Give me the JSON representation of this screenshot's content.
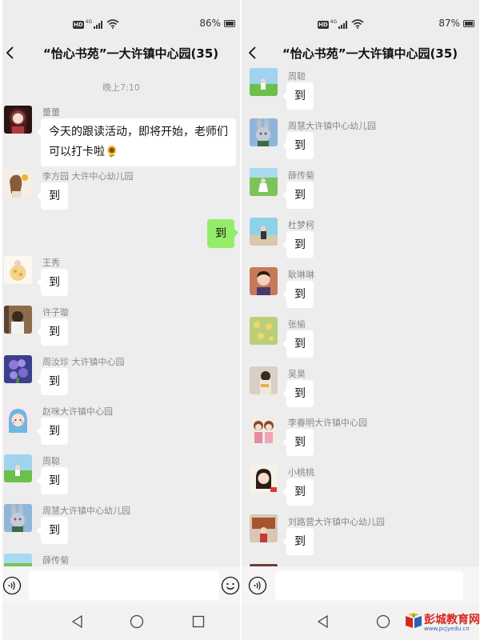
{
  "left_pane": {
    "status": {
      "network": "4G",
      "battery": "86%"
    },
    "title": "“怡心书苑”一大许镇中心园(35)",
    "timestamp": "晚上7:10",
    "messages": [
      {
        "sender": "蕾蕾",
        "text": "今天的跟读活动，即将开始，老师们可以打卡啦🌻"
      },
      {
        "sender": "李方园 大许中心幼儿园",
        "text": "到"
      },
      {
        "sender": "",
        "text": "到"
      },
      {
        "sender": "王秀",
        "text": "到"
      },
      {
        "sender": "许子璇",
        "text": "到"
      },
      {
        "sender": "周汝珍  大许镇中心园",
        "text": "到"
      },
      {
        "sender": "赵咪大许镇中心园",
        "text": "到"
      },
      {
        "sender": "周聪",
        "text": "到"
      },
      {
        "sender": "周慧大许镇中心幼儿园",
        "text": "到"
      },
      {
        "sender": "薛传菊",
        "text": ""
      }
    ]
  },
  "right_pane": {
    "status": {
      "network": "4G",
      "battery": "87%"
    },
    "title": "“怡心书苑”一大许镇中心园(35)",
    "messages": [
      {
        "sender": "周聪",
        "text": "到"
      },
      {
        "sender": "周慧大许镇中心幼儿园",
        "text": "到"
      },
      {
        "sender": "薛传菊",
        "text": "到"
      },
      {
        "sender": "杜梦柯",
        "text": "到"
      },
      {
        "sender": "耿琳琳",
        "text": "到"
      },
      {
        "sender": "张榆",
        "text": "到"
      },
      {
        "sender": "吴昊",
        "text": "到"
      },
      {
        "sender": "李春明大许镇中心园",
        "text": "到"
      },
      {
        "sender": "小桃桃",
        "text": "到"
      },
      {
        "sender": "刘路营大许镇中心幼儿园",
        "text": "到"
      }
    ]
  },
  "watermark": {
    "name": "彭城教育网",
    "url": "www.pcjyedu.cn"
  },
  "icons": {
    "back": "back-arrow-icon",
    "voice": "voice-icon",
    "emoji": "emoji-icon",
    "nav_back": "triangle-back-icon",
    "nav_home": "circle-home-icon",
    "nav_recent": "square-recent-icon"
  },
  "colors": {
    "chat_background": "#ededed",
    "self_bubble": "#95ec69",
    "other_bubble": "#ffffff",
    "watermark_red": "#d6281f",
    "watermark_blue": "#2a62b8"
  }
}
